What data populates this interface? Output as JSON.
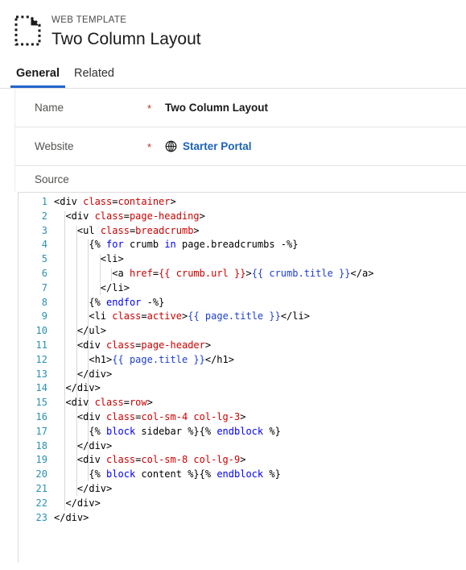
{
  "header": {
    "entity_type": "WEB TEMPLATE",
    "record_title": "Two Column Layout",
    "icon": "web-template-document-icon"
  },
  "tabs": [
    {
      "label": "General",
      "active": true
    },
    {
      "label": "Related",
      "active": false
    }
  ],
  "form": {
    "rows": [
      {
        "label": "Name",
        "required": "*",
        "value": "Two Column Layout",
        "type": "text"
      },
      {
        "label": "Website",
        "required": "*",
        "value": "Starter Portal",
        "type": "lookup",
        "icon": "globe-icon"
      }
    ],
    "source_label": "Source"
  },
  "editor": {
    "language": "html-liquid",
    "line_count": 23,
    "lines": [
      {
        "n": "1",
        "indent": 0,
        "tokens": [
          {
            "t": "tag",
            "v": "<div "
          },
          {
            "t": "attr",
            "v": "class"
          },
          {
            "t": "tag",
            "v": "="
          },
          {
            "t": "val",
            "v": "container"
          },
          {
            "t": "tag",
            "v": ">"
          }
        ]
      },
      {
        "n": "2",
        "indent": 1,
        "tokens": [
          {
            "t": "tag",
            "v": "<div "
          },
          {
            "t": "attr",
            "v": "class"
          },
          {
            "t": "tag",
            "v": "="
          },
          {
            "t": "val",
            "v": "page-heading"
          },
          {
            "t": "tag",
            "v": ">"
          }
        ]
      },
      {
        "n": "3",
        "indent": 2,
        "tokens": [
          {
            "t": "tag",
            "v": "<ul "
          },
          {
            "t": "attr",
            "v": "class"
          },
          {
            "t": "tag",
            "v": "="
          },
          {
            "t": "val",
            "v": "breadcrumb"
          },
          {
            "t": "tag",
            "v": ">"
          }
        ]
      },
      {
        "n": "4",
        "indent": 3,
        "tokens": [
          {
            "t": "plain",
            "v": "{% "
          },
          {
            "t": "kw",
            "v": "for"
          },
          {
            "t": "plain",
            "v": " crumb "
          },
          {
            "t": "kw",
            "v": "in"
          },
          {
            "t": "plain",
            "v": " page.breadcrumbs -%}"
          }
        ]
      },
      {
        "n": "5",
        "indent": 4,
        "tokens": [
          {
            "t": "tag",
            "v": "<li>"
          }
        ]
      },
      {
        "n": "6",
        "indent": 5,
        "tokens": [
          {
            "t": "tag",
            "v": "<a "
          },
          {
            "t": "attr",
            "v": "href"
          },
          {
            "t": "tag",
            "v": "="
          },
          {
            "t": "val",
            "v": "{{ crumb.url }}"
          },
          {
            "t": "tag",
            "v": ">"
          },
          {
            "t": "out",
            "v": "{{ crumb.title }}"
          },
          {
            "t": "tag",
            "v": "</a>"
          }
        ]
      },
      {
        "n": "7",
        "indent": 4,
        "tokens": [
          {
            "t": "tag",
            "v": "</li>"
          }
        ]
      },
      {
        "n": "8",
        "indent": 3,
        "tokens": [
          {
            "t": "plain",
            "v": "{% "
          },
          {
            "t": "kw",
            "v": "endfor"
          },
          {
            "t": "plain",
            "v": " -%}"
          }
        ]
      },
      {
        "n": "9",
        "indent": 3,
        "tokens": [
          {
            "t": "tag",
            "v": "<li "
          },
          {
            "t": "attr",
            "v": "class"
          },
          {
            "t": "tag",
            "v": "="
          },
          {
            "t": "val",
            "v": "active"
          },
          {
            "t": "tag",
            "v": ">"
          },
          {
            "t": "out",
            "v": "{{ page.title }}"
          },
          {
            "t": "tag",
            "v": "</li>"
          }
        ]
      },
      {
        "n": "10",
        "indent": 2,
        "tokens": [
          {
            "t": "tag",
            "v": "</ul>"
          }
        ]
      },
      {
        "n": "11",
        "indent": 2,
        "tokens": [
          {
            "t": "tag",
            "v": "<div "
          },
          {
            "t": "attr",
            "v": "class"
          },
          {
            "t": "tag",
            "v": "="
          },
          {
            "t": "val",
            "v": "page-header"
          },
          {
            "t": "tag",
            "v": ">"
          }
        ]
      },
      {
        "n": "12",
        "indent": 3,
        "tokens": [
          {
            "t": "tag",
            "v": "<h1>"
          },
          {
            "t": "out",
            "v": "{{ page.title }}"
          },
          {
            "t": "tag",
            "v": "</h1>"
          }
        ]
      },
      {
        "n": "13",
        "indent": 2,
        "tokens": [
          {
            "t": "tag",
            "v": "</div>"
          }
        ]
      },
      {
        "n": "14",
        "indent": 1,
        "tokens": [
          {
            "t": "tag",
            "v": "</div>"
          }
        ]
      },
      {
        "n": "15",
        "indent": 1,
        "tokens": [
          {
            "t": "tag",
            "v": "<div "
          },
          {
            "t": "attr",
            "v": "class"
          },
          {
            "t": "tag",
            "v": "="
          },
          {
            "t": "val",
            "v": "row"
          },
          {
            "t": "tag",
            "v": ">"
          }
        ]
      },
      {
        "n": "16",
        "indent": 2,
        "tokens": [
          {
            "t": "tag",
            "v": "<div "
          },
          {
            "t": "attr",
            "v": "class"
          },
          {
            "t": "tag",
            "v": "="
          },
          {
            "t": "val",
            "v": "col-sm-4 col-lg-3"
          },
          {
            "t": "tag",
            "v": ">"
          }
        ]
      },
      {
        "n": "17",
        "indent": 3,
        "tokens": [
          {
            "t": "plain",
            "v": "{% "
          },
          {
            "t": "kw",
            "v": "block"
          },
          {
            "t": "plain",
            "v": " sidebar %}{% "
          },
          {
            "t": "kw",
            "v": "endblock"
          },
          {
            "t": "plain",
            "v": " %}"
          }
        ]
      },
      {
        "n": "18",
        "indent": 2,
        "tokens": [
          {
            "t": "tag",
            "v": "</div>"
          }
        ]
      },
      {
        "n": "19",
        "indent": 2,
        "tokens": [
          {
            "t": "tag",
            "v": "<div "
          },
          {
            "t": "attr",
            "v": "class"
          },
          {
            "t": "tag",
            "v": "="
          },
          {
            "t": "val",
            "v": "col-sm-8 col-lg-9"
          },
          {
            "t": "tag",
            "v": ">"
          }
        ]
      },
      {
        "n": "20",
        "indent": 3,
        "tokens": [
          {
            "t": "plain",
            "v": "{% "
          },
          {
            "t": "kw",
            "v": "block"
          },
          {
            "t": "plain",
            "v": " content %}{% "
          },
          {
            "t": "kw",
            "v": "endblock"
          },
          {
            "t": "plain",
            "v": " %}"
          }
        ]
      },
      {
        "n": "21",
        "indent": 2,
        "tokens": [
          {
            "t": "tag",
            "v": "</div>"
          }
        ]
      },
      {
        "n": "22",
        "indent": 1,
        "tokens": [
          {
            "t": "tag",
            "v": "</div>"
          }
        ]
      },
      {
        "n": "23",
        "indent": 0,
        "tokens": [
          {
            "t": "tag",
            "v": "</div>"
          }
        ]
      }
    ]
  },
  "colors": {
    "accent": "#2266cc",
    "link": "#1a63b8",
    "required": "#c42b1c",
    "line_number": "#2b91af",
    "code_attr": "#cc0000",
    "code_keyword": "#0000ff",
    "code_output": "#1f3fcf"
  }
}
